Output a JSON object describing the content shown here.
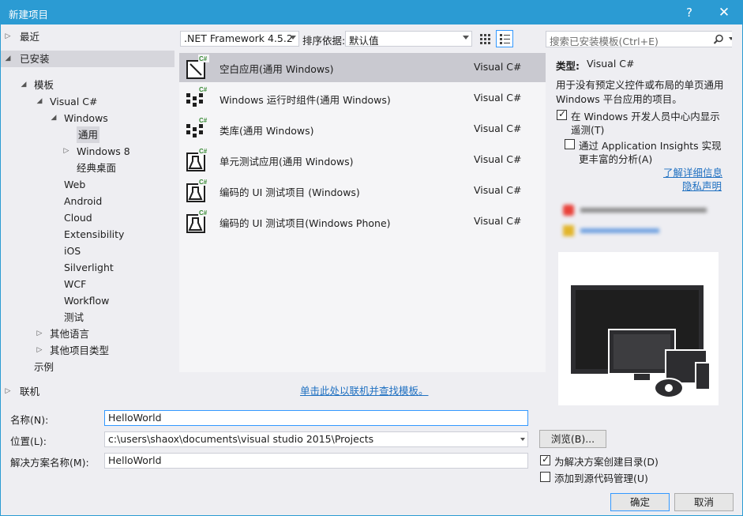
{
  "window": {
    "title": "新建项目",
    "help": "?",
    "close": "✕"
  },
  "tree": [
    {
      "label": "最近",
      "arrow": "▷",
      "indent": 0
    },
    {
      "label": "已安装",
      "arrow": "◢",
      "indent": 0
    },
    {
      "label": "模板",
      "arrow": "◢",
      "indent": 1
    },
    {
      "label": "Visual C#",
      "arrow": "◢",
      "indent": 2
    },
    {
      "label": "Windows",
      "arrow": "◢",
      "indent": 3
    },
    {
      "label": "通用",
      "arrow": "",
      "indent": 4
    },
    {
      "label": "Windows 8",
      "arrow": "▷",
      "indent": 4
    },
    {
      "label": "经典桌面",
      "arrow": "",
      "indent": 4
    },
    {
      "label": "Web",
      "arrow": "",
      "indent": 3
    },
    {
      "label": "Android",
      "arrow": "",
      "indent": 3
    },
    {
      "label": "Cloud",
      "arrow": "",
      "indent": 3
    },
    {
      "label": "Extensibility",
      "arrow": "",
      "indent": 3
    },
    {
      "label": "iOS",
      "arrow": "",
      "indent": 3
    },
    {
      "label": "Silverlight",
      "arrow": "",
      "indent": 3
    },
    {
      "label": "WCF",
      "arrow": "",
      "indent": 3
    },
    {
      "label": "Workflow",
      "arrow": "",
      "indent": 3
    },
    {
      "label": "测试",
      "arrow": "",
      "indent": 3
    },
    {
      "label": "其他语言",
      "arrow": "▷",
      "indent": 2
    },
    {
      "label": "其他项目类型",
      "arrow": "▷",
      "indent": 2
    },
    {
      "label": "示例",
      "arrow": "",
      "indent": 1
    },
    {
      "label": "联机",
      "arrow": "▷",
      "indent": 0
    }
  ],
  "toolbar": {
    "framework": ".NET Framework 4.5.2",
    "sort_label": "排序依据:",
    "sort_value": "默认值"
  },
  "templates": [
    {
      "name": "空白应用(通用 Windows)",
      "lang": "Visual C#",
      "icon": "blank-app-icon"
    },
    {
      "name": "Windows 运行时组件(通用 Windows)",
      "lang": "Visual C#",
      "icon": "runtime-component-icon"
    },
    {
      "name": "类库(通用 Windows)",
      "lang": "Visual C#",
      "icon": "class-library-icon"
    },
    {
      "name": "单元测试应用(通用 Windows)",
      "lang": "Visual C#",
      "icon": "unit-test-icon"
    },
    {
      "name": "编码的 UI 测试项目 (Windows)",
      "lang": "Visual C#",
      "icon": "coded-ui-test-icon"
    },
    {
      "name": "编码的 UI 测试项目(Windows Phone)",
      "lang": "Visual C#",
      "icon": "coded-ui-test-phone-icon"
    }
  ],
  "online_link": "单击此处以联机并查找模板。",
  "right": {
    "search_placeholder": "搜索已安装模板(Ctrl+E)",
    "type_label": "类型:",
    "type_value": "Visual C#",
    "desc_line1": "用于没有预定义控件或布局的单页通用",
    "desc_line2": "Windows 平台应用的项目。",
    "cb1_line1": "在 Windows 开发人员中心内显示",
    "cb1_line2": "遥测(T)",
    "cb2_line1": "通过 Application Insights 实现",
    "cb2_line2": "更丰富的分析(A)",
    "more_info": "了解详细信息",
    "privacy": "隐私声明"
  },
  "form": {
    "name_label": "名称(N):",
    "name_value": "HelloWorld",
    "location_label": "位置(L):",
    "location_value": "c:\\users\\shaox\\documents\\visual studio 2015\\Projects",
    "solution_label": "解决方案名称(M):",
    "solution_value": "HelloWorld",
    "browse": "浏览(B)...",
    "create_dir": "为解决方案创建目录(D)",
    "add_scc": "添加到源代码管理(U)",
    "ok": "确定",
    "cancel": "取消"
  },
  "colors": {
    "accent": "#2b9bd3",
    "link": "#1f70c1",
    "selected": "#c9c9d0"
  }
}
